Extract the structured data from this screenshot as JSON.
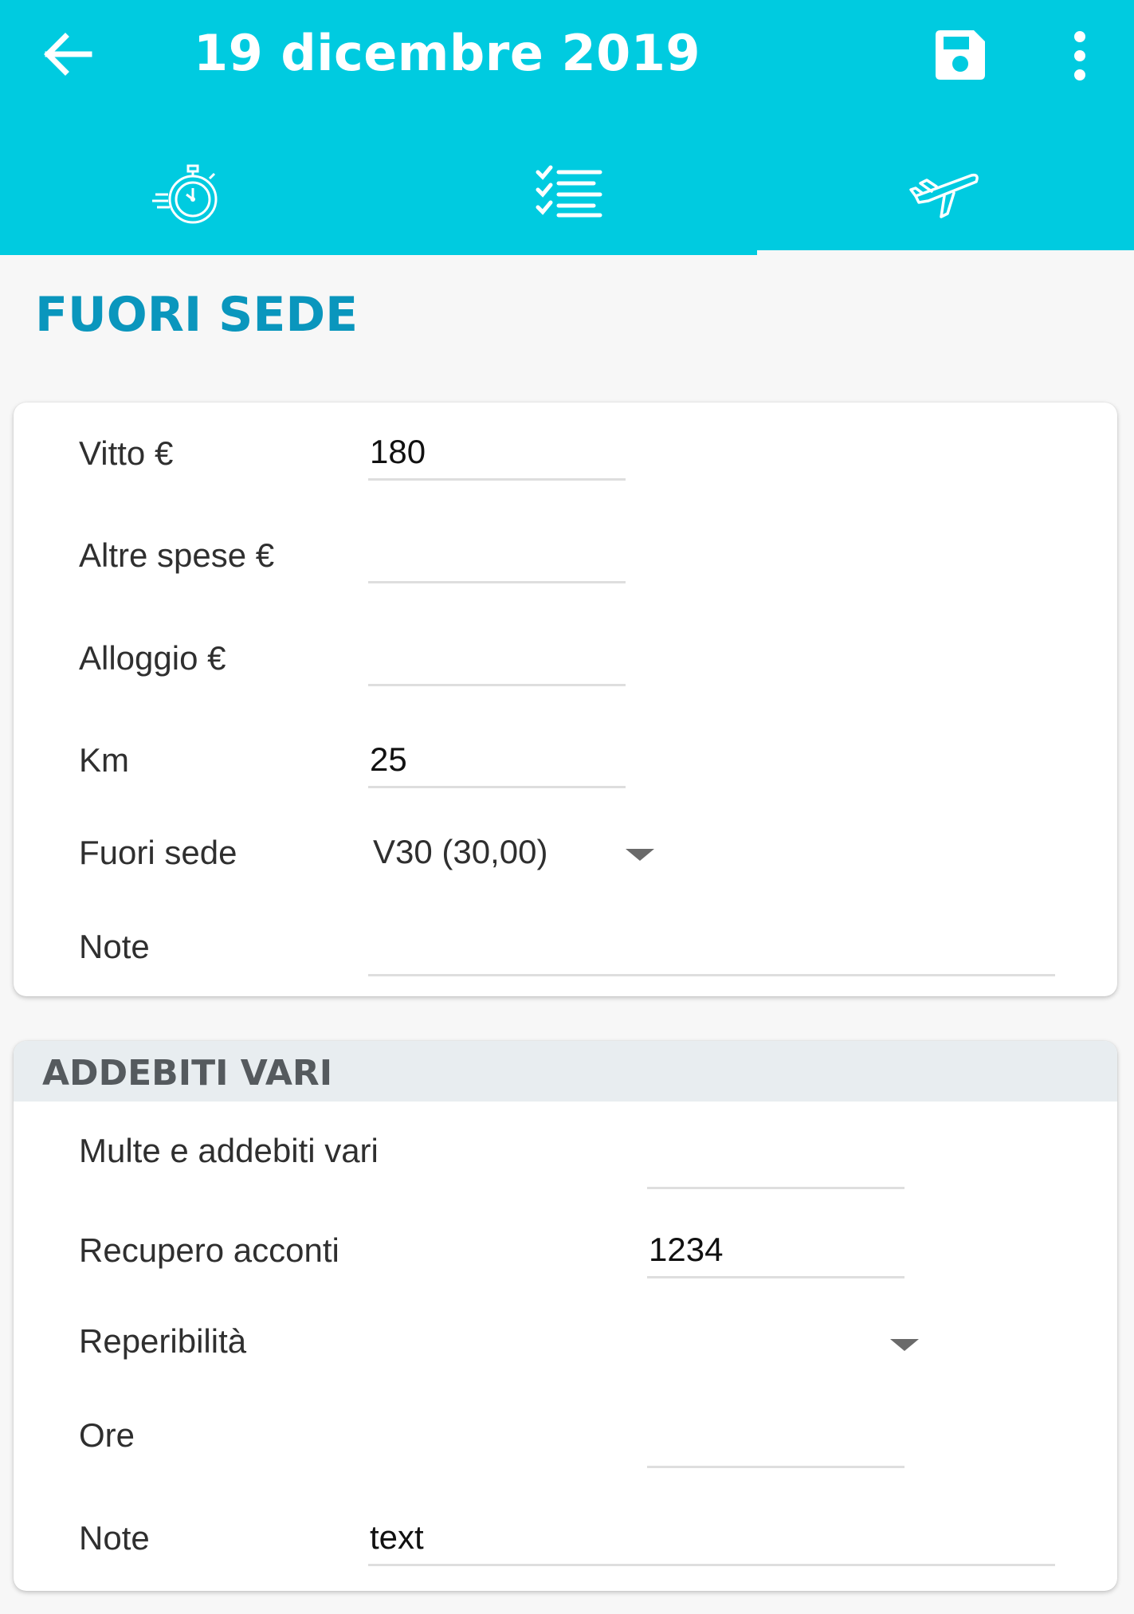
{
  "header": {
    "title": "19 dicembre 2019",
    "background_color": "#00cbe0",
    "back_icon": "arrow-left-icon",
    "save_icon": "floppy-disk-icon",
    "more_icon": "more-vertical-icon"
  },
  "tabs": [
    {
      "icon": "stopwatch-icon",
      "selected": false
    },
    {
      "icon": "checklist-icon",
      "selected": false
    },
    {
      "icon": "airplane-icon",
      "selected": true
    }
  ],
  "section": {
    "title": "FUORI SEDE",
    "title_color": "#0a96bd"
  },
  "fuori_sede_card": {
    "vitto": {
      "label": "Vitto €",
      "value": "180"
    },
    "altre_spese": {
      "label": "Altre spese €",
      "value": ""
    },
    "alloggio": {
      "label": "Alloggio €",
      "value": ""
    },
    "km": {
      "label": "Km",
      "value": "25"
    },
    "fuori_sede": {
      "label": "Fuori sede",
      "selected": "V30 (30,00)"
    },
    "note": {
      "label": "Note",
      "value": ""
    }
  },
  "addebiti_card": {
    "title": "ADDEBITI VARI",
    "multe": {
      "label": "Multe e addebiti vari",
      "value": ""
    },
    "recupero": {
      "label": "Recupero acconti",
      "value": "1234"
    },
    "reperibilita": {
      "label": "Reperibilità",
      "selected": ""
    },
    "ore": {
      "label": "Ore",
      "value": ""
    },
    "note": {
      "label": "Note",
      "value": "text"
    }
  }
}
